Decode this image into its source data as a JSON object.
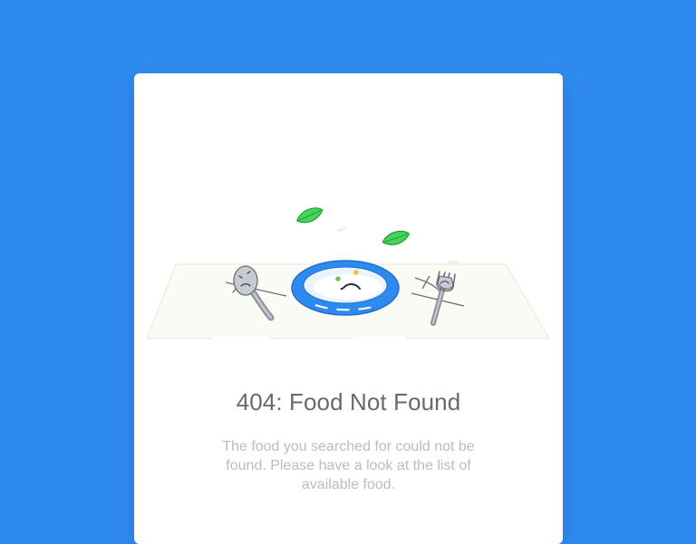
{
  "error_card": {
    "title": "404: Food Not Found",
    "description": "The food you searched for could not be found. Please have a look at the list of available food."
  },
  "colors": {
    "background": "#2f8af0",
    "card": "#ffffff",
    "title": "#666a70",
    "description": "#b9bcc1",
    "plate_blue": "#2f8af0",
    "leaf_green": "#33d14a",
    "placemat": "#fbfbf5"
  },
  "icons": [
    "empty-plate-icon",
    "sad-spoon-icon",
    "sad-fork-icon",
    "leaf-icon"
  ]
}
